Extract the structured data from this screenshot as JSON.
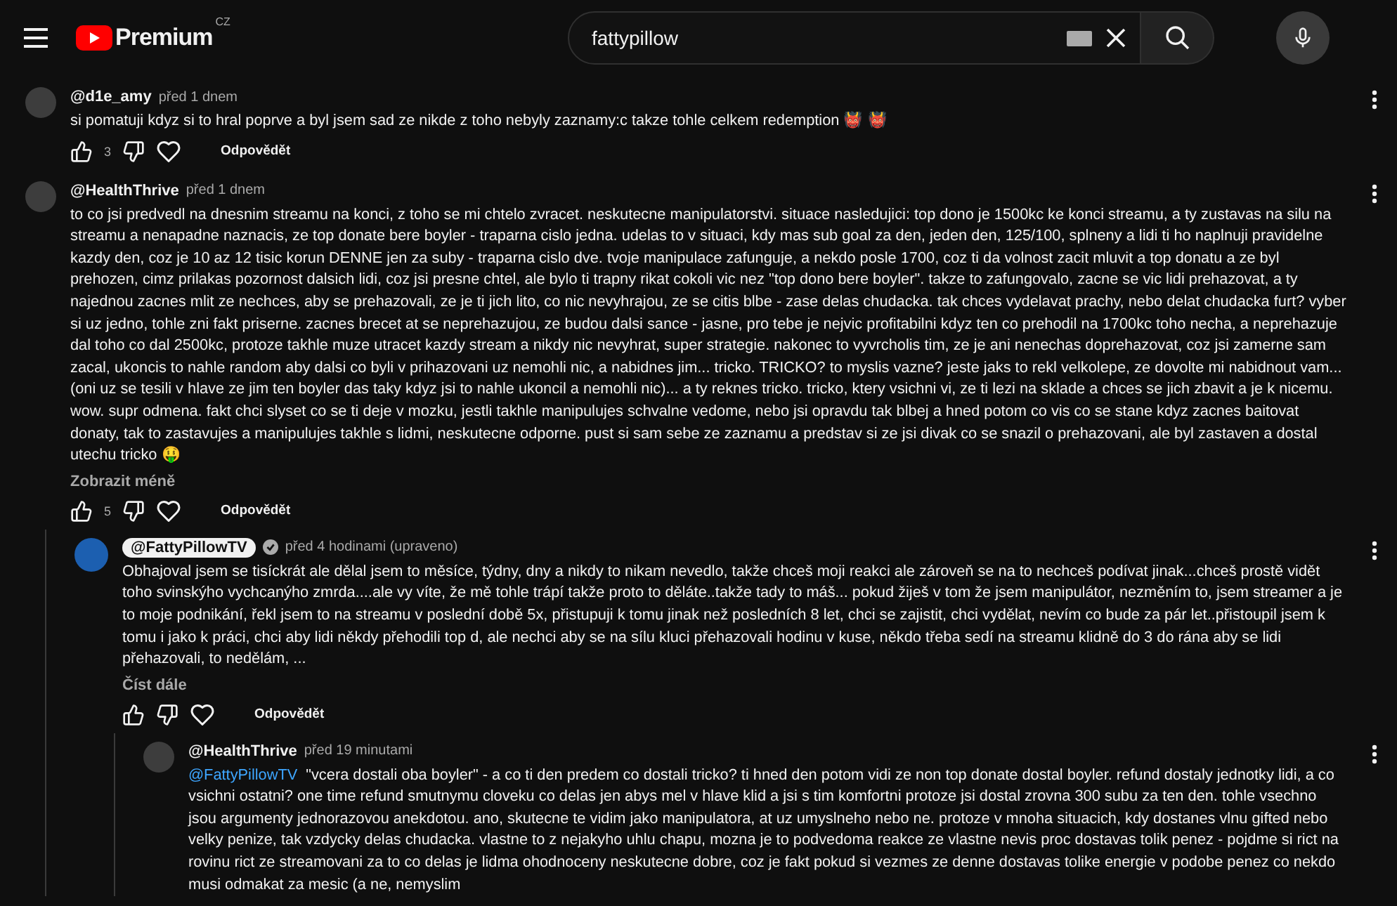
{
  "header": {
    "logo_text": "Premium",
    "region": "CZ",
    "search": {
      "value": "fattypillow"
    }
  },
  "comments": [
    {
      "author": "@d1e_amy",
      "time": "před 1 dnem",
      "owner": false,
      "text": "si pomatuji kdyz si to hral poprve a byl jsem sad ze nikde z toho nebyly zaznamy:c takze tohle celkem redemption 👹 👹",
      "likes": "3",
      "reply_label": "Odpovědět"
    },
    {
      "author": "@HealthThrive",
      "time": "před 1 dnem",
      "owner": false,
      "text": "to co jsi predvedl na dnesnim streamu na konci, z toho se mi chtelo zvracet. neskutecne manipulatorstvi. situace nasledujici: top dono je 1500kc ke konci streamu, a ty zustavas na silu na streamu a nenapadne naznacis, ze top donate bere boyler - traparna cislo jedna. udelas to v situaci, kdy mas sub goal za den, jeden den, 125/100, splneny a lidi ti ho naplnuji pravidelne kazdy den, coz je 10 az 12 tisic korun DENNE jen za suby - traparna cislo dve. tvoje manipulace zafunguje, a nekdo posle 1700, coz ti da volnost zacit mluvit a top donatu a ze byl prehozen, cimz prilakas pozornost dalsich lidi, coz jsi presne chtel, ale bylo ti trapny rikat cokoli vic nez \"top dono bere boyler\". takze to zafungovalo, zacne se vic lidi prehazovat, a ty najednou zacnes mlit ze nechces, aby se prehazovali, ze je ti jich lito, co nic nevyhrajou, ze se citis blbe - zase delas chudacka. tak chces vydelavat prachy, nebo delat chudacka furt? vyber si uz jedno, tohle zni fakt priserne. zacnes brecet at se neprehazujou, ze budou dalsi sance - jasne, pro tebe je nejvic profitabilni kdyz ten co prehodil na 1700kc toho necha, a neprehazuje dal toho co dal 2500kc, protoze takhle muze utracet kazdy stream a nikdy nic nevyhrat, super strategie. nakonec to vyvrcholis tim, ze je ani nenechas doprehazovat, coz jsi zamerne sam zacal, ukoncis to nahle random aby dalsi co byli v prihazovani uz nemohli nic, a nabidnes jim... tricko. TRICKO? to myslis vazne? jeste jaks to rekl velkolepe, ze dovolte mi nabidnout vam... (oni uz se tesili v hlave ze jim ten boyler das taky kdyz jsi to nahle ukoncil a nemohli nic)... a ty reknes tricko. tricko, ktery vsichni vi, ze ti lezi na sklade a chces se jich zbavit a je k nicemu. wow. supr odmena. fakt chci slyset co se ti deje v mozku, jestli takhle manipulujes schvalne vedome, nebo jsi opravdu tak blbej a hned potom co vis co se stane kdyz zacnes baitovat donaty, tak to zastavujes a manipulujes takhle s lidmi, neskutecne odporne. pust si sam sebe ze zaznamu a predstav si ze jsi divak co se snazil o prehazovani, ale byl zastaven a dostal utechu tricko 🤑",
      "toggle": "Zobrazit méně",
      "likes": "5",
      "reply_label": "Odpovědět",
      "children": [
        {
          "author": "@FattyPillowTV",
          "time": "před 4 hodinami (upraveno)",
          "owner": true,
          "text": "Obhajoval jsem se tisíckrát ale dělal jsem to měsíce, týdny, dny a nikdy to nikam nevedlo, takže chceš moji reakci ale zároveň se na to nechceš podívat jinak...chceš prostě vidět toho svinskýho vychcanýho zmrda....ale vy víte, že mě tohle trápí takže proto to děláte..takže tady to máš... pokud žiješ v tom že jsem manipulátor, nezměním to, jsem streamer a je to moje podnikání, řekl jsem to na streamu v poslední době 5x, přistupuji k tomu jinak než posledních 8 let, chci se zajistit, chci vydělat, nevím co bude za pár let..přistoupil jsem k tomu i jako k práci, chci aby lidi někdy přehodili top d, ale nechci aby se na sílu kluci přehazovali hodinu v kuse, někdo třeba sedí na streamu klidně do 3 do rána aby se lidi přehazovali, to nedělám, ...",
          "toggle": "Číst dále",
          "reply_label": "Odpovědět",
          "children": [
            {
              "author": "@HealthThrive",
              "time": "před 19 minutami",
              "owner": false,
              "mention": "@FattyPillowTV",
              "text": "\"vcera dostali oba boyler\" - a co ti den predem co dostali tricko? ti hned den potom vidi ze non top donate dostal boyler. refund dostaly jednotky lidi, a co vsichni ostatni? one time refund smutnymu cloveku co delas jen abys mel v hlave klid a jsi s tim komfortni protoze jsi dostal zrovna 300 subu za ten den. tohle vsechno jsou argumenty jednorazovou anekdotou. ano, skutecne te vidim jako manipulatora, at uz umyslneho nebo ne. protoze v mnoha situacich, kdy dostanes vlnu gifted nebo velky penize, tak vzdycky delas chudacka. vlastne to z nejakyho uhlu chapu, mozna je to podvedoma reakce ze vlastne nevis proc dostavas tolik penez - pojdme si rict na rovinu rict ze streamovani za to co delas je lidma ohodnoceny neskutecne dobre, coz je fakt pokud si vezmes ze denne dostavas tolike energie v podobe penez co nekdo musi odmakat za mesic (a ne, nemyslim"
            }
          ]
        }
      ]
    }
  ]
}
